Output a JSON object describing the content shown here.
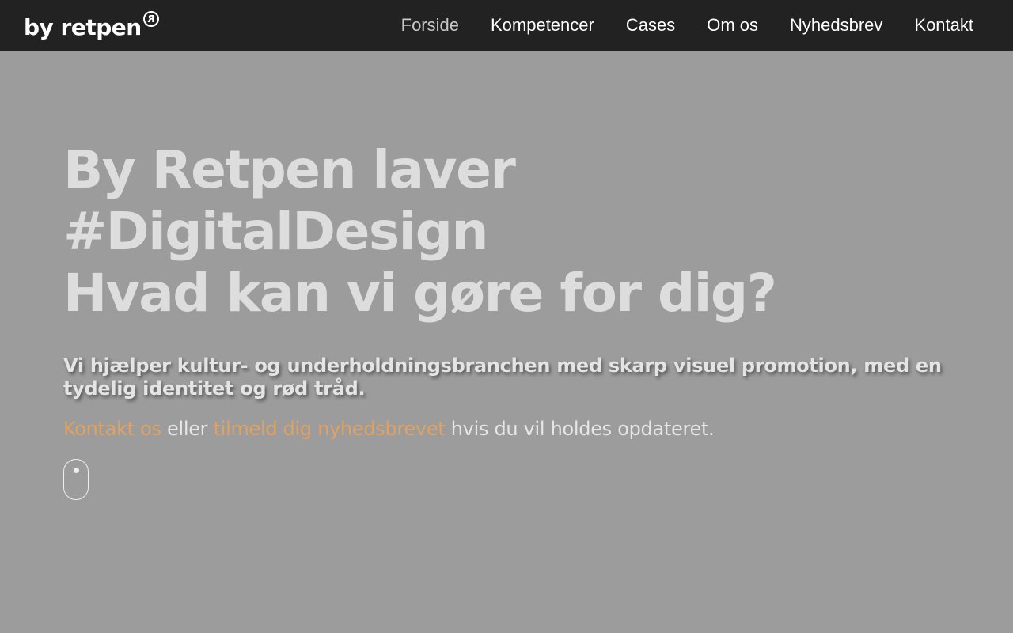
{
  "header": {
    "logo": {
      "text": "by retpen",
      "mark": "R"
    },
    "nav": [
      {
        "label": "Forside",
        "active": true
      },
      {
        "label": "Kompetencer",
        "active": false
      },
      {
        "label": "Cases",
        "active": false
      },
      {
        "label": "Om os",
        "active": false
      },
      {
        "label": "Nyhedsbrev",
        "active": false
      },
      {
        "label": "Kontakt",
        "active": false
      }
    ]
  },
  "hero": {
    "heading_lines": [
      "By Retpen laver",
      "#DigitalDesign",
      "Hvad kan vi gøre for dig?"
    ],
    "subheading": "Vi hjælper kultur- og underholdningsbranchen med skarp visuel promotion, med en tydelig identitet og rød tråd.",
    "cta": {
      "link_contact": "Kontakt os",
      "text_or": " eller ",
      "link_newsletter": "tilmeld dig nyhedsbrevet",
      "text_tail": " hvis du vil holdes opdateret."
    },
    "scroll_indicator_icon": "mouse-scroll-icon"
  },
  "colors": {
    "topbar_bg": "#222222",
    "page_bg": "#9c9c9c",
    "heading": "#dddddd",
    "link_accent": "#e0a262",
    "nav_active": "#c9c9c9",
    "nav_text": "#ffffff"
  }
}
